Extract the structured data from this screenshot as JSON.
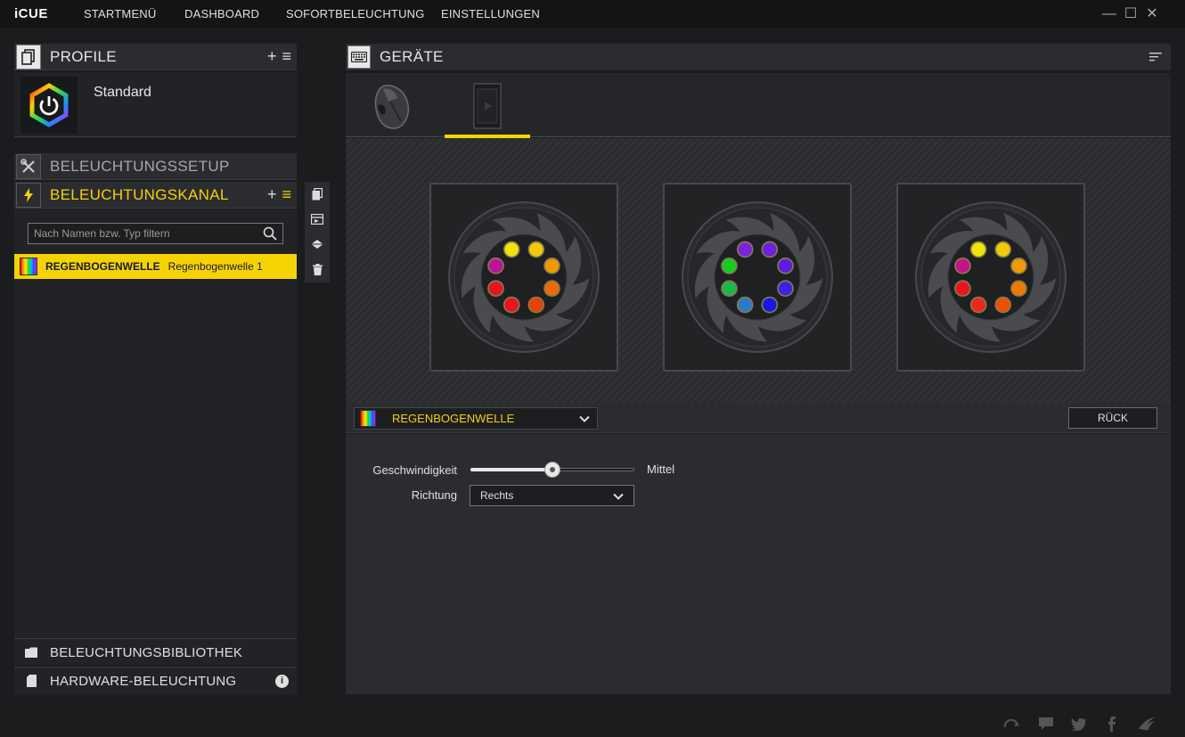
{
  "app": {
    "logo": "iCUE"
  },
  "nav": {
    "items": [
      {
        "label": "STARTMENÜ"
      },
      {
        "label": "DASHBOARD"
      },
      {
        "label": "SOFORTBELEUCHTUNG"
      },
      {
        "label": "EINSTELLUNGEN"
      }
    ]
  },
  "window": {
    "minimize": "—",
    "maximize": "☐",
    "close": "✕"
  },
  "profile": {
    "title": "PROFILE",
    "name": "Standard",
    "add": "+",
    "menu": "≡"
  },
  "lighting_setup": {
    "title": "BELEUCHTUNGSSETUP"
  },
  "lighting_channel": {
    "title": "BELEUCHTUNGSKANAL",
    "add": "+",
    "menu": "≡",
    "search_placeholder": "Nach Namen bzw. Typ filtern",
    "effects": [
      {
        "type": "REGENBOGENWELLE",
        "name": "Regenbogenwelle 1"
      }
    ]
  },
  "library": {
    "title": "BELEUCHTUNGSBIBLIOTHEK"
  },
  "hardware": {
    "title": "HARDWARE-BELEUCHTUNG",
    "info": "i"
  },
  "devices": {
    "title": "GERÄTE"
  },
  "effect_editor": {
    "selected_effect": "REGENBOGENWELLE",
    "back_label": "RÜCK",
    "speed_label": "Geschwindigkeit",
    "speed_value": "Mittel",
    "speed_fraction": 0.5,
    "direction_label": "Richtung",
    "direction_value": "Rechts"
  },
  "fans": [
    {
      "leds": [
        "#e8141e",
        "#b8149e",
        "#f2e400",
        "#f2cc00",
        "#ee9a00",
        "#ee6a00",
        "#ea4200",
        "#e8141e"
      ]
    },
    {
      "leds": [
        "#1bb84a",
        "#16cc20",
        "#7a22e0",
        "#6a20de",
        "#5a1ee0",
        "#3a22e6",
        "#1818e6",
        "#2a7ac8"
      ]
    },
    {
      "leds": [
        "#e8141e",
        "#c4148a",
        "#f2e400",
        "#f2cc00",
        "#ee9a00",
        "#ee7a00",
        "#ea5200",
        "#e82a1a"
      ]
    }
  ],
  "colors": {
    "accent": "#f5d300",
    "panel": "#2b2c2f",
    "background": "#1b1c1e"
  }
}
